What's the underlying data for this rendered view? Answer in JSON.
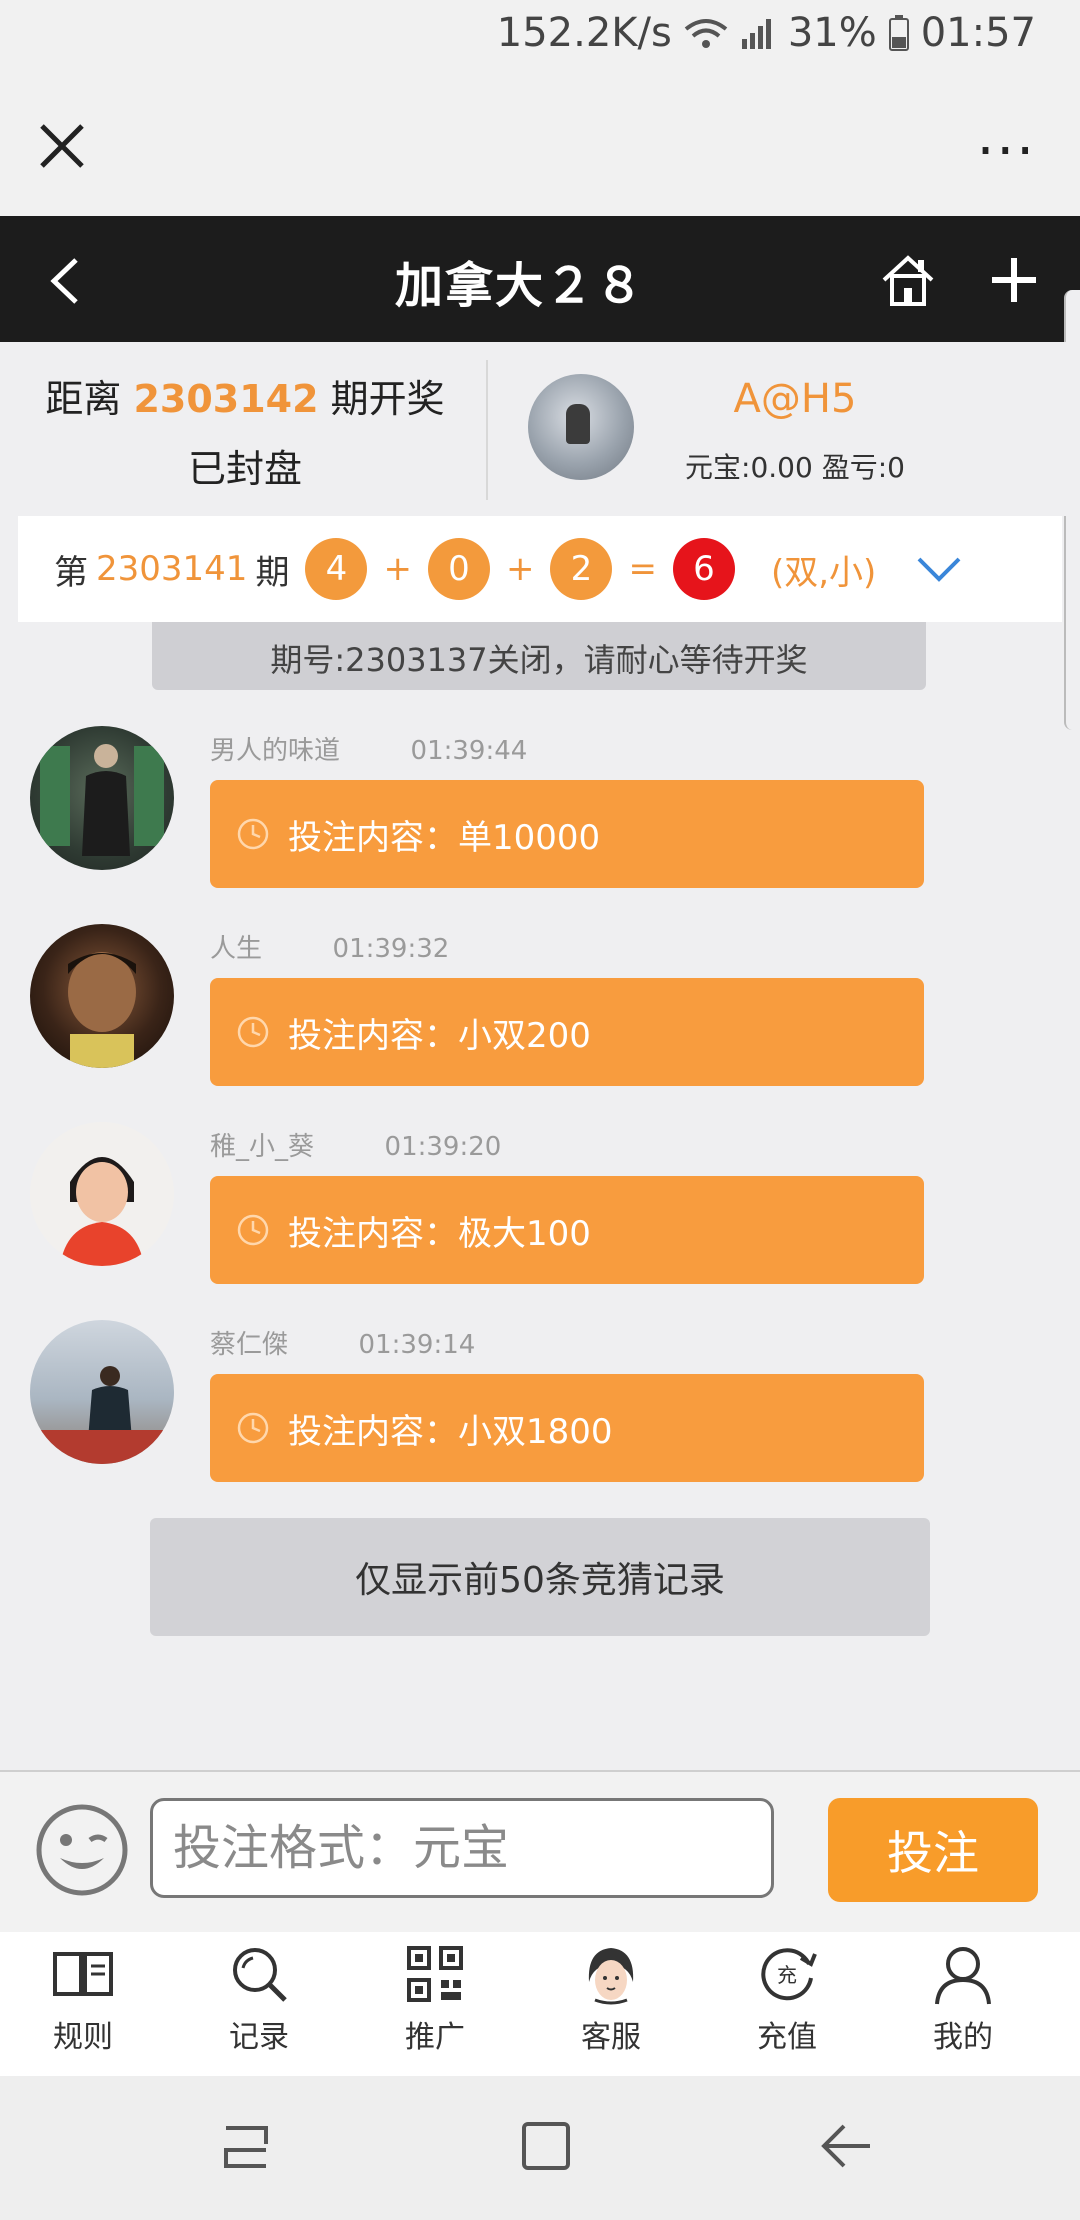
{
  "status_bar": {
    "network_speed": "152.2K/s",
    "battery": "31%",
    "time": "01:57"
  },
  "header": {
    "title": "加拿大２８"
  },
  "draw_info": {
    "countdown_prefix": "距离",
    "period_number": "2303142",
    "countdown_suffix": "期开奖",
    "status": "已封盘"
  },
  "user": {
    "name": "A@H5",
    "balance": "元宝:0.00 盈亏:0"
  },
  "last_result": {
    "prefix": "第",
    "period": "2303141",
    "suffix": "期",
    "balls": [
      "4",
      "0",
      "2"
    ],
    "plus": "+",
    "equals": "=",
    "sum": "6",
    "parity": "(双,小)"
  },
  "system_message": "期号:2303137关闭，请耐心等待开奖",
  "messages": [
    {
      "user": "男人的味道",
      "time": "01:39:44",
      "content": "投注内容：单10000"
    },
    {
      "user": "人生",
      "time": "01:39:32",
      "content": "投注内容：小双200"
    },
    {
      "user": "稚_小_葵",
      "time": "01:39:20",
      "content": "投注内容：极大100"
    },
    {
      "user": "蔡仁傑",
      "time": "01:39:14",
      "content": "投注内容：小双1800"
    }
  ],
  "notice": "仅显示前50条竞猜记录",
  "input": {
    "placeholder": "投注格式：元宝",
    "submit_label": "投注"
  },
  "tabs": [
    {
      "label": "规则",
      "icon": "book-icon"
    },
    {
      "label": "记录",
      "icon": "search-icon"
    },
    {
      "label": "推广",
      "icon": "qr-code-icon"
    },
    {
      "label": "客服",
      "icon": "customer-service-icon"
    },
    {
      "label": "充值",
      "icon": "recharge-icon"
    },
    {
      "label": "我的",
      "icon": "profile-icon"
    }
  ],
  "colors": {
    "accent": "#f89c3e",
    "ball_orange": "#f39a3c",
    "ball_red": "#e6141b",
    "header_bg": "#1c1c1c"
  }
}
